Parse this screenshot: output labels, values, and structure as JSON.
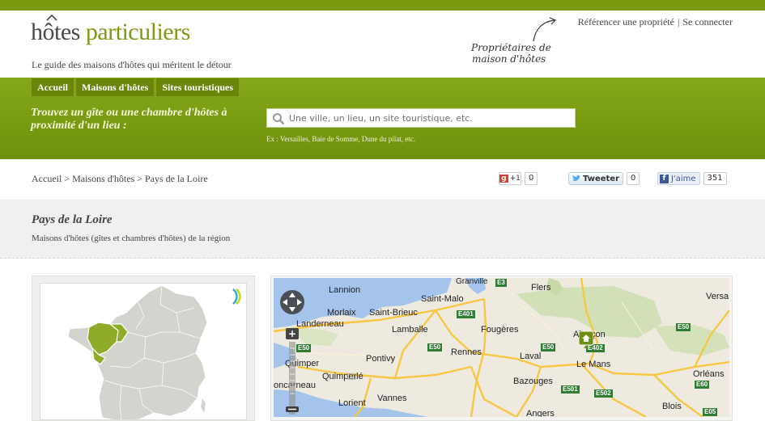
{
  "header": {
    "logo_word1": "hôtes",
    "logo_word2": "particuliers",
    "tagline": "Le guide des maisons d'hôtes qui méritent le détour",
    "owners_line1": "Propriétaires de",
    "owners_line2": "maison d'hôtes",
    "link_reference": "Référencer une propriété",
    "link_separator": "|",
    "link_login": "Se connecter"
  },
  "nav": {
    "items": [
      {
        "label": "Accueil"
      },
      {
        "label": "Maisons d'hôtes"
      },
      {
        "label": "Sites touristiques"
      }
    ]
  },
  "search": {
    "label": "Trouvez un gîte ou une chambre d'hôtes à proximité d'un lieu :",
    "placeholder": "Une ville, un lieu, un site touristique, etc.",
    "examples": "Ex : Versailles, Baie de Somme, Dune du pilat, etc."
  },
  "breadcrumb": "Accueil > Maisons d'hôtes > Pays de la Loire",
  "social": {
    "gplus_label": "+1",
    "gplus_count": "0",
    "twitter_label": "Tweeter",
    "twitter_count": "0",
    "facebook_label": "J'aime",
    "facebook_count": "351"
  },
  "region": {
    "title": "Pays de la Loire",
    "subtitle": "Maisons d'hôtes (gîtes et chambres d'hôtes) de la région"
  },
  "map": {
    "cities": {
      "lannion": "Lannion",
      "saint_malo": "Saint-Malo",
      "granville": "Granville",
      "flers": "Flers",
      "versailles": "Versa",
      "morlaix": "Morlaix",
      "saint_brieuc": "Saint-Brieuc",
      "landerneau": "Landerneau",
      "lamballe": "Lamballe",
      "fougeres": "Fougères",
      "alencon": "Alençon",
      "quimper": "Quimper",
      "pontivy": "Pontivy",
      "rennes": "Rennes",
      "laval": "Laval",
      "le_mans": "Le Mans",
      "quimperle": "Quimperlé",
      "concarneau": "oncarneau",
      "bazouges": "Bazouges",
      "orleans": "Orléans",
      "lorient": "Lorient",
      "vannes": "Vannes",
      "blois": "Blois",
      "angers": "Angers"
    },
    "roads": {
      "e3": "E3",
      "e401": "E401",
      "e50a": "E50",
      "e50b": "E50",
      "e50c": "E50",
      "e402": "E402",
      "e501": "E501",
      "e502": "E502",
      "e60": "E60",
      "e05": "E05",
      "e50d": "E50"
    }
  },
  "colors": {
    "brand_green": "#7a9a0f",
    "nav_green": "#67860a",
    "region_highlight": "#8cac2a"
  }
}
